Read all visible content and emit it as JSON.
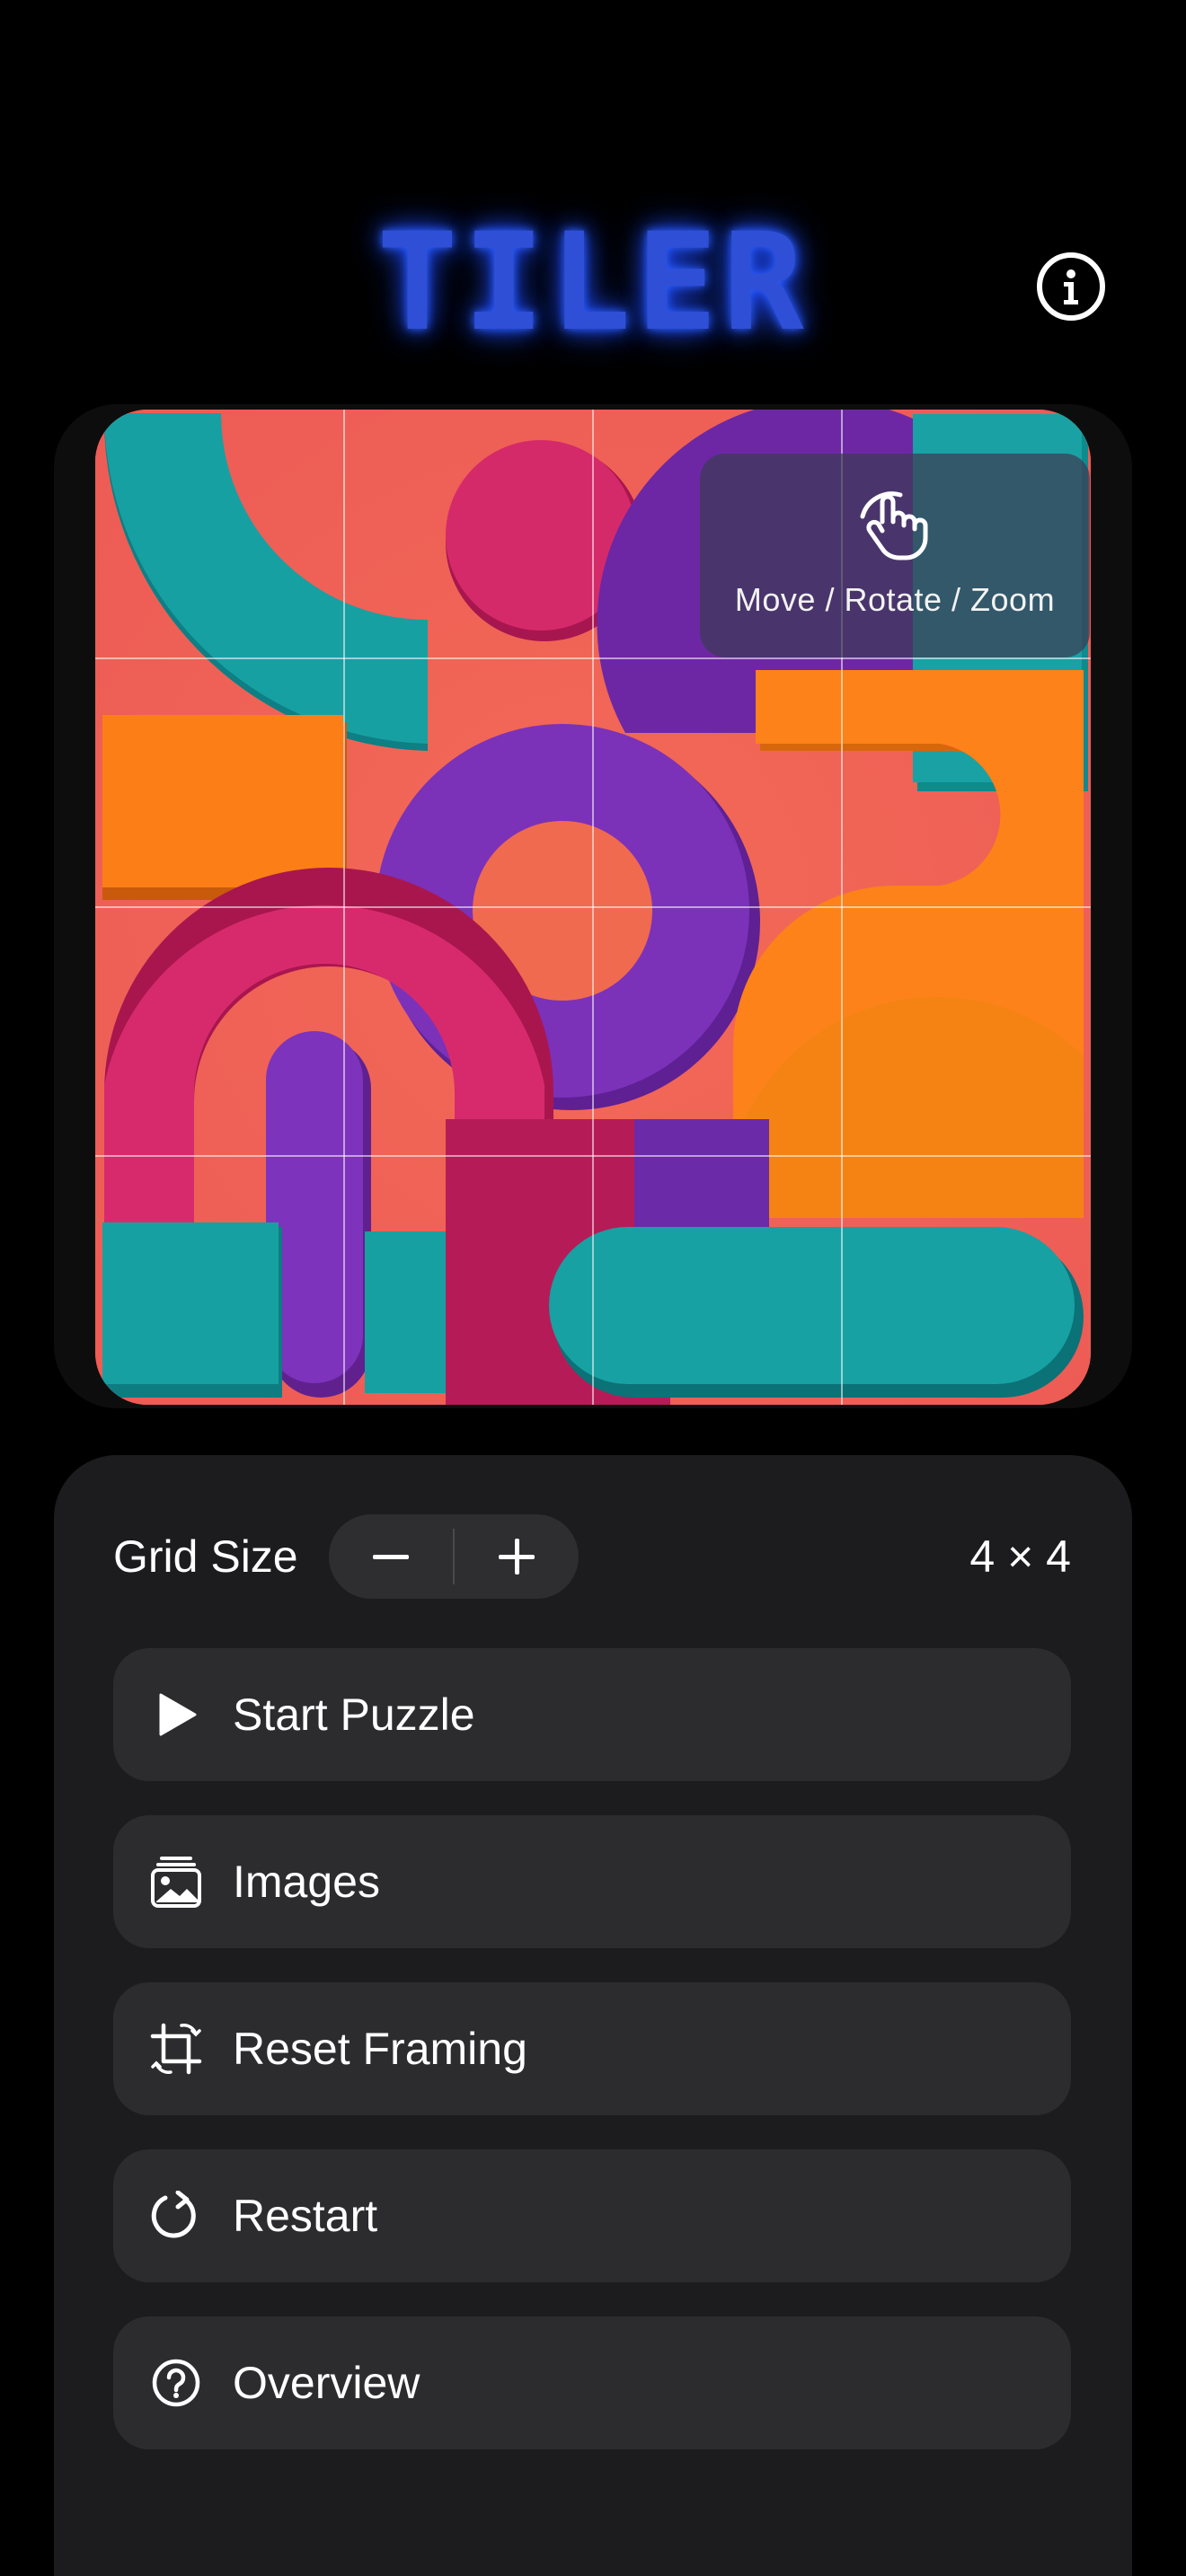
{
  "app": {
    "logo_text": "TILER"
  },
  "header": {
    "info_icon": "info-icon"
  },
  "puzzle": {
    "grid_rows": 4,
    "grid_cols": 4,
    "hint": {
      "label": "Move / Rotate / Zoom",
      "icon": "hand-gesture-icon"
    },
    "colors": {
      "background": "#f1665b",
      "teal": "#14999b",
      "magenta": "#d2246a",
      "purple": "#7b30b8",
      "orange": "#fb7a12"
    }
  },
  "controls": {
    "grid_size_label": "Grid Size",
    "minus_icon": "minus-icon",
    "plus_icon": "plus-icon",
    "grid_value": "4 × 4"
  },
  "actions": [
    {
      "label": "Start Puzzle",
      "icon": "play-icon"
    },
    {
      "label": "Images",
      "icon": "photo-stack-icon"
    },
    {
      "label": "Reset Framing",
      "icon": "crop-rotate-icon"
    },
    {
      "label": "Restart",
      "icon": "restart-icon"
    },
    {
      "label": "Overview",
      "icon": "question-circle-icon"
    }
  ]
}
